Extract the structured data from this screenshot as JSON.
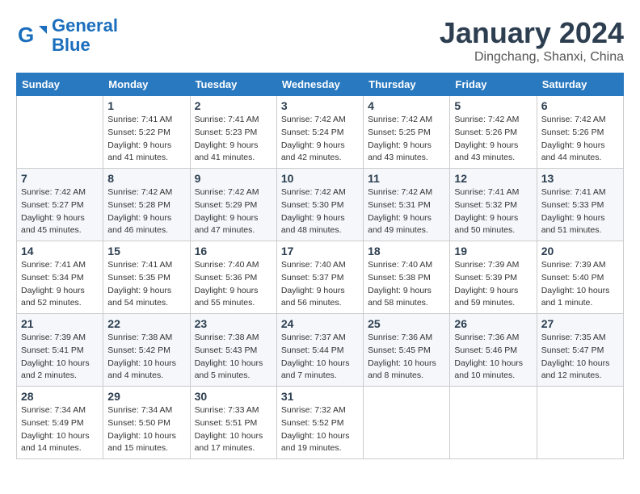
{
  "header": {
    "logo_line1": "General",
    "logo_line2": "Blue",
    "month_title": "January 2024",
    "subtitle": "Dingchang, Shanxi, China"
  },
  "weekdays": [
    "Sunday",
    "Monday",
    "Tuesday",
    "Wednesday",
    "Thursday",
    "Friday",
    "Saturday"
  ],
  "weeks": [
    [
      {
        "day": "",
        "info": ""
      },
      {
        "day": "1",
        "info": "Sunrise: 7:41 AM\nSunset: 5:22 PM\nDaylight: 9 hours\nand 41 minutes."
      },
      {
        "day": "2",
        "info": "Sunrise: 7:41 AM\nSunset: 5:23 PM\nDaylight: 9 hours\nand 41 minutes."
      },
      {
        "day": "3",
        "info": "Sunrise: 7:42 AM\nSunset: 5:24 PM\nDaylight: 9 hours\nand 42 minutes."
      },
      {
        "day": "4",
        "info": "Sunrise: 7:42 AM\nSunset: 5:25 PM\nDaylight: 9 hours\nand 43 minutes."
      },
      {
        "day": "5",
        "info": "Sunrise: 7:42 AM\nSunset: 5:26 PM\nDaylight: 9 hours\nand 43 minutes."
      },
      {
        "day": "6",
        "info": "Sunrise: 7:42 AM\nSunset: 5:26 PM\nDaylight: 9 hours\nand 44 minutes."
      }
    ],
    [
      {
        "day": "7",
        "info": "Sunrise: 7:42 AM\nSunset: 5:27 PM\nDaylight: 9 hours\nand 45 minutes."
      },
      {
        "day": "8",
        "info": "Sunrise: 7:42 AM\nSunset: 5:28 PM\nDaylight: 9 hours\nand 46 minutes."
      },
      {
        "day": "9",
        "info": "Sunrise: 7:42 AM\nSunset: 5:29 PM\nDaylight: 9 hours\nand 47 minutes."
      },
      {
        "day": "10",
        "info": "Sunrise: 7:42 AM\nSunset: 5:30 PM\nDaylight: 9 hours\nand 48 minutes."
      },
      {
        "day": "11",
        "info": "Sunrise: 7:42 AM\nSunset: 5:31 PM\nDaylight: 9 hours\nand 49 minutes."
      },
      {
        "day": "12",
        "info": "Sunrise: 7:41 AM\nSunset: 5:32 PM\nDaylight: 9 hours\nand 50 minutes."
      },
      {
        "day": "13",
        "info": "Sunrise: 7:41 AM\nSunset: 5:33 PM\nDaylight: 9 hours\nand 51 minutes."
      }
    ],
    [
      {
        "day": "14",
        "info": "Sunrise: 7:41 AM\nSunset: 5:34 PM\nDaylight: 9 hours\nand 52 minutes."
      },
      {
        "day": "15",
        "info": "Sunrise: 7:41 AM\nSunset: 5:35 PM\nDaylight: 9 hours\nand 54 minutes."
      },
      {
        "day": "16",
        "info": "Sunrise: 7:40 AM\nSunset: 5:36 PM\nDaylight: 9 hours\nand 55 minutes."
      },
      {
        "day": "17",
        "info": "Sunrise: 7:40 AM\nSunset: 5:37 PM\nDaylight: 9 hours\nand 56 minutes."
      },
      {
        "day": "18",
        "info": "Sunrise: 7:40 AM\nSunset: 5:38 PM\nDaylight: 9 hours\nand 58 minutes."
      },
      {
        "day": "19",
        "info": "Sunrise: 7:39 AM\nSunset: 5:39 PM\nDaylight: 9 hours\nand 59 minutes."
      },
      {
        "day": "20",
        "info": "Sunrise: 7:39 AM\nSunset: 5:40 PM\nDaylight: 10 hours\nand 1 minute."
      }
    ],
    [
      {
        "day": "21",
        "info": "Sunrise: 7:39 AM\nSunset: 5:41 PM\nDaylight: 10 hours\nand 2 minutes."
      },
      {
        "day": "22",
        "info": "Sunrise: 7:38 AM\nSunset: 5:42 PM\nDaylight: 10 hours\nand 4 minutes."
      },
      {
        "day": "23",
        "info": "Sunrise: 7:38 AM\nSunset: 5:43 PM\nDaylight: 10 hours\nand 5 minutes."
      },
      {
        "day": "24",
        "info": "Sunrise: 7:37 AM\nSunset: 5:44 PM\nDaylight: 10 hours\nand 7 minutes."
      },
      {
        "day": "25",
        "info": "Sunrise: 7:36 AM\nSunset: 5:45 PM\nDaylight: 10 hours\nand 8 minutes."
      },
      {
        "day": "26",
        "info": "Sunrise: 7:36 AM\nSunset: 5:46 PM\nDaylight: 10 hours\nand 10 minutes."
      },
      {
        "day": "27",
        "info": "Sunrise: 7:35 AM\nSunset: 5:47 PM\nDaylight: 10 hours\nand 12 minutes."
      }
    ],
    [
      {
        "day": "28",
        "info": "Sunrise: 7:34 AM\nSunset: 5:49 PM\nDaylight: 10 hours\nand 14 minutes."
      },
      {
        "day": "29",
        "info": "Sunrise: 7:34 AM\nSunset: 5:50 PM\nDaylight: 10 hours\nand 15 minutes."
      },
      {
        "day": "30",
        "info": "Sunrise: 7:33 AM\nSunset: 5:51 PM\nDaylight: 10 hours\nand 17 minutes."
      },
      {
        "day": "31",
        "info": "Sunrise: 7:32 AM\nSunset: 5:52 PM\nDaylight: 10 hours\nand 19 minutes."
      },
      {
        "day": "",
        "info": ""
      },
      {
        "day": "",
        "info": ""
      },
      {
        "day": "",
        "info": ""
      }
    ]
  ]
}
